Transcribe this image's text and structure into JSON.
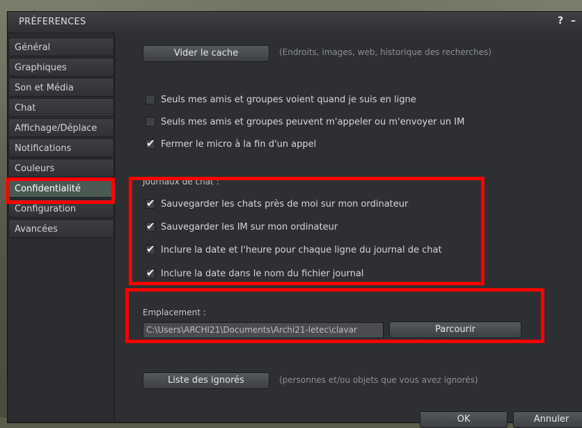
{
  "window": {
    "title": "PRÉFERENCES",
    "help": "?",
    "minimize": "–"
  },
  "sidebar": {
    "items": [
      {
        "label": "Général"
      },
      {
        "label": "Graphiques"
      },
      {
        "label": "Son et Média"
      },
      {
        "label": "Chat"
      },
      {
        "label": "Affichage/Déplace"
      },
      {
        "label": "Notifications"
      },
      {
        "label": "Couleurs"
      },
      {
        "label": "Confidentialité",
        "active": true
      },
      {
        "label": "Configuration"
      },
      {
        "label": "Avancées"
      }
    ]
  },
  "privacy": {
    "clear_cache_button": "Vider le cache",
    "clear_cache_hint": "(Endroits, images, web, historique des recherches)",
    "online_friends_only": {
      "label": "Seuls mes amis et groupes voient quand je suis en ligne",
      "checked": false
    },
    "im_friends_only": {
      "label": "Seuls mes amis et groupes peuvent m'appeler ou m'envoyer un IM",
      "checked": false
    },
    "mute_mic_end_call": {
      "label": "Fermer le micro à la fin d'un appel",
      "checked": true
    }
  },
  "chat_logs": {
    "heading": "Journaux de chat :",
    "save_nearby": {
      "label": "Sauvegarder les chats près de moi sur mon ordinateur",
      "checked": true
    },
    "save_im": {
      "label": "Sauvegarder les IM sur mon ordinateur",
      "checked": true
    },
    "include_datetime": {
      "label": "Inclure la date et l'heure pour chaque ligne du journal de chat",
      "checked": true
    },
    "include_date_filename": {
      "label": "Inclure la date dans le nom du fichier journal",
      "checked": true
    }
  },
  "location": {
    "label": "Emplacement :",
    "path": "C:\\Users\\ARCHI21\\Documents\\Archi21-letec\\clavar",
    "browse_button": "Parcourir"
  },
  "ignore": {
    "button": "Liste des ignorés",
    "hint": "(personnes et/ou objets que vous avez ignorés)"
  },
  "footer": {
    "ok": "OK",
    "cancel": "Annuler"
  },
  "colors": {
    "highlight": "#ff0000",
    "active_tab": "#4a5a52"
  }
}
